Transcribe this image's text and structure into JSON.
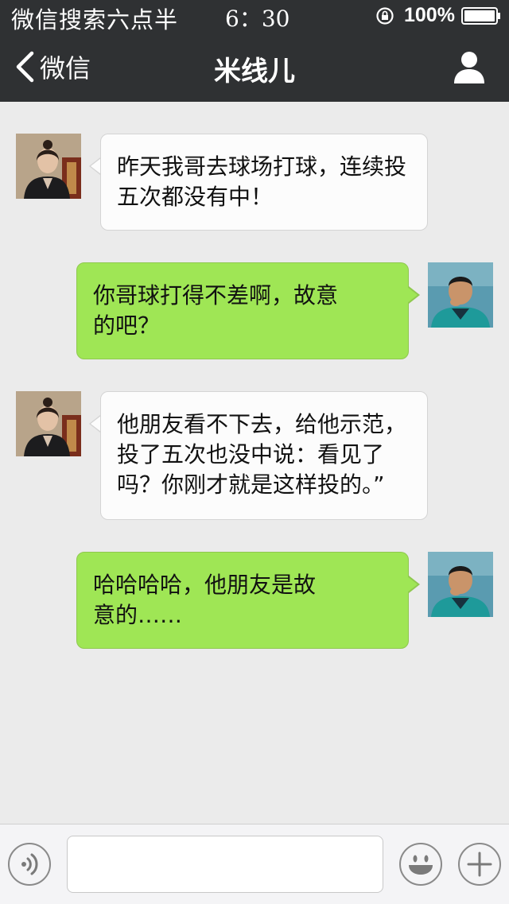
{
  "status_bar": {
    "carrier": "微信搜索六点半",
    "time": "6：30",
    "battery": "100%",
    "icons": [
      "rotation-lock-icon",
      "battery-icon"
    ]
  },
  "nav": {
    "back_label": "微信",
    "title": "米线儿",
    "icons": [
      "back-chevron-icon",
      "person-profile-icon"
    ]
  },
  "messages": [
    {
      "direction": "incoming",
      "sender": "contact",
      "text": "昨天我哥去球场打球，连续投五次都没有中！"
    },
    {
      "direction": "outgoing",
      "sender": "me",
      "text": "你哥球打得不差啊，故意的吧？"
    },
    {
      "direction": "incoming",
      "sender": "contact",
      "text": "他朋友看不下去，给他示范，投了五次也没中说：看见了吗？你刚才就是这样投的。”"
    },
    {
      "direction": "outgoing",
      "sender": "me",
      "text": "哈哈哈哈，他朋友是故意的……"
    }
  ],
  "input_bar": {
    "message_value": "",
    "icons": [
      "voice-icon",
      "emoji-icon",
      "plus-icon"
    ]
  },
  "colors": {
    "bar_background": "#2f3133",
    "chat_background": "#ebebeb",
    "incoming_bubble": "#fcfcfc",
    "outgoing_bubble": "#9fe655"
  }
}
